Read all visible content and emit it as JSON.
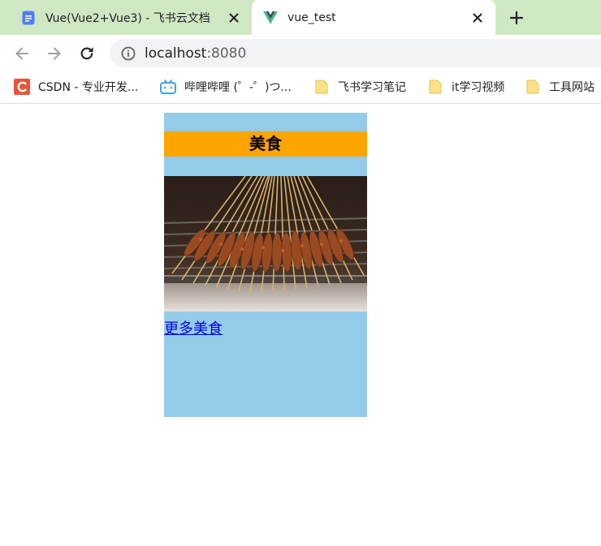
{
  "browser": {
    "tabs": [
      {
        "title": "Vue(Vue2+Vue3) - 飞书云文档",
        "favicon": "feishu-doc-icon",
        "active": false
      },
      {
        "title": "vue_test",
        "favicon": "vue-logo-icon",
        "active": true
      }
    ],
    "address_bar": {
      "host": "localhost",
      "port": ":8080"
    },
    "bookmarks": [
      {
        "label": "CSDN - 专业开发...",
        "icon": "csdn-icon"
      },
      {
        "label": "哔哩哔哩 (゜-゜)つ...",
        "icon": "bilibili-icon"
      },
      {
        "label": "飞书学习笔记",
        "icon": "folder-icon"
      },
      {
        "label": "it学习视频",
        "icon": "folder-icon"
      },
      {
        "label": "工具网站",
        "icon": "folder-icon"
      }
    ]
  },
  "page": {
    "category": {
      "title": "美食",
      "link_text": "更多美食"
    }
  },
  "colors": {
    "tabstrip": "#cfe8c3",
    "card_background": "#93cbe9",
    "card_title_background": "#ffa500",
    "link": "#0000ee"
  }
}
